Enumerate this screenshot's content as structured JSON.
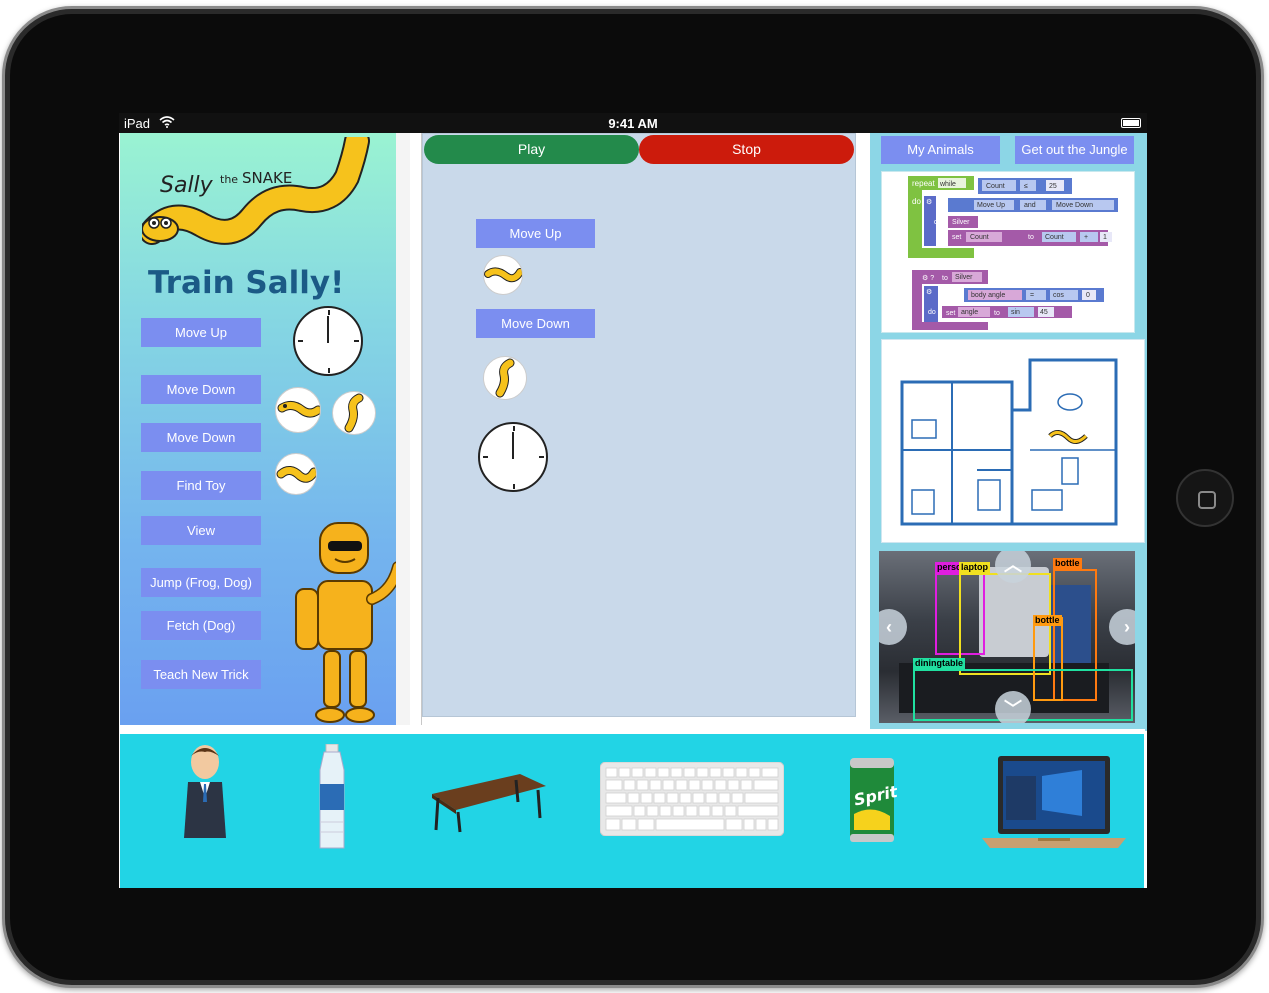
{
  "statusbar": {
    "carrier": "iPad",
    "time": "9:41 AM"
  },
  "left": {
    "title": "Train Sally!",
    "commands": [
      {
        "label": "Move Up"
      },
      {
        "label": "Move Down"
      },
      {
        "label": "Move Down"
      },
      {
        "label": "Find Toy"
      },
      {
        "label": "View"
      },
      {
        "label": "Jump (Frog, Dog)"
      },
      {
        "label": "Fetch (Dog)"
      },
      {
        "label": "Teach New Trick"
      }
    ]
  },
  "logo": {
    "line1": "Sally",
    "line2": "the",
    "line3": "SNAKE"
  },
  "center": {
    "play_label": "Play",
    "stop_label": "Stop",
    "sequence": [
      {
        "label": "Move Up"
      },
      {
        "label": "Move Down"
      }
    ]
  },
  "right": {
    "my_animals_label": "My Animals",
    "jungle_label": "Get out the Jungle",
    "blocks": {
      "repeat": "repeat",
      "while": "while",
      "do": "do",
      "if": "if",
      "count": "Count",
      "lte": "≤",
      "twentyfive": "25",
      "move_up": "Move Up",
      "and": "and",
      "move_down": "Move Down",
      "silver": "Silver",
      "set": "set",
      "to": "to",
      "plus": "+",
      "one": "1",
      "to_silver": "to",
      "silver2": "Silver",
      "body_angle": "body angle",
      "eq": "=",
      "cos": "cos",
      "zero": "0",
      "angle": "angle",
      "sin": "sin",
      "fortyfive": "45"
    },
    "detections": [
      {
        "label": "person",
        "color": "#e01ee0"
      },
      {
        "label": "laptop",
        "color": "#f0e020"
      },
      {
        "label": "bottle",
        "color": "#ff7a10"
      },
      {
        "label": "bottle",
        "color": "#ff9a10"
      },
      {
        "label": "diningtable",
        "color": "#20e0a0"
      }
    ]
  },
  "tray": {
    "items": [
      "person-figure",
      "water-bottle",
      "table",
      "keyboard",
      "sprite-can",
      "laptop"
    ],
    "can_text": "Sprite"
  },
  "colors": {
    "button": "#7b8ef0",
    "play": "#238a4b",
    "stop": "#cc1b0c",
    "tray": "#22d4e5",
    "title": "#1b5a86"
  }
}
